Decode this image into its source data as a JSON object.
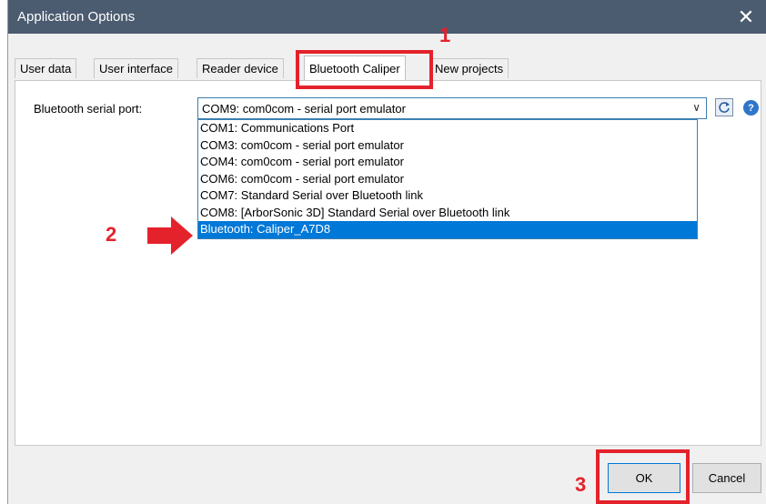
{
  "window": {
    "title": "Application Options"
  },
  "tabs": [
    {
      "label": "User data"
    },
    {
      "label": "User interface"
    },
    {
      "label": "Reader device"
    },
    {
      "label": "Bluetooth Caliper",
      "active": true
    },
    {
      "label": "New projects"
    }
  ],
  "bluetooth": {
    "port_label": "Bluetooth serial port:",
    "selected_value": "COM9: com0com - serial port emulator",
    "options": [
      "COM1: Communications Port",
      "COM3: com0com - serial port emulator",
      "COM4: com0com - serial port emulator",
      "COM6: com0com - serial port emulator",
      "COM7: Standard Serial over Bluetooth link",
      "COM8: [ArborSonic 3D] Standard Serial over Bluetooth link",
      "Bluetooth: Caliper_A7D8"
    ],
    "highlighted_option": "Bluetooth: Caliper_A7D8",
    "help_glyph": "?"
  },
  "buttons": {
    "ok": "OK",
    "cancel": "Cancel"
  },
  "annotations": {
    "step1": "1",
    "step2": "2",
    "step3": "3"
  },
  "icons": {
    "close": "close-icon",
    "dropdown": "chevron-down-icon",
    "refresh": "refresh-icon",
    "help": "help-icon",
    "arrow": "arrow-right-icon"
  },
  "colors": {
    "titlebar": "#4b5b70",
    "annotation": "#e4222b",
    "selection": "#0078d7",
    "window_bg": "#f0f0f0"
  }
}
